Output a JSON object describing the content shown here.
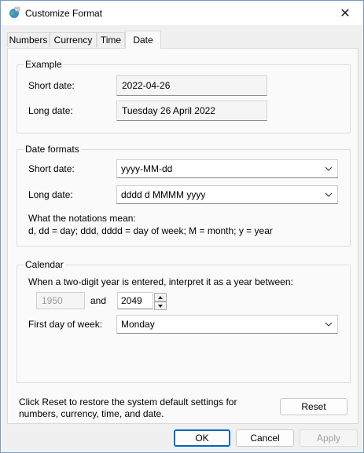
{
  "window": {
    "title": "Customize Format",
    "close_symbol": "✕"
  },
  "tabs": [
    {
      "label": "Numbers"
    },
    {
      "label": "Currency"
    },
    {
      "label": "Time"
    },
    {
      "label": "Date"
    }
  ],
  "active_tab": "Date",
  "example": {
    "group_label": "Example",
    "short_label": "Short date:",
    "short_value": "2022-04-26",
    "long_label": "Long date:",
    "long_value": "Tuesday 26 April 2022"
  },
  "date_formats": {
    "group_label": "Date formats",
    "short_label": "Short date:",
    "short_value": "yyyy-MM-dd",
    "long_label": "Long date:",
    "long_value": "dddd d MMMM yyyy",
    "notation_heading": "What the notations mean:",
    "notation_text": "d, dd = day;  ddd, dddd = day of week;  M = month;  y = year"
  },
  "calendar": {
    "group_label": "Calendar",
    "two_digit_text": "When a two-digit year is entered, interpret it as a year between:",
    "year_start": "1950",
    "and_label": "and",
    "year_end": "2049",
    "first_day_label": "First day of week:",
    "first_day_value": "Monday"
  },
  "reset": {
    "text_line1": "Click Reset to restore the system default settings for",
    "text_line2": "numbers, currency, time, and date.",
    "button_label": "Reset"
  },
  "footer": {
    "ok_label": "OK",
    "cancel_label": "Cancel",
    "apply_label": "Apply"
  },
  "colors": {
    "accent": "#0067c0",
    "panel": "#fafafa",
    "window": "#f0f0f0"
  }
}
